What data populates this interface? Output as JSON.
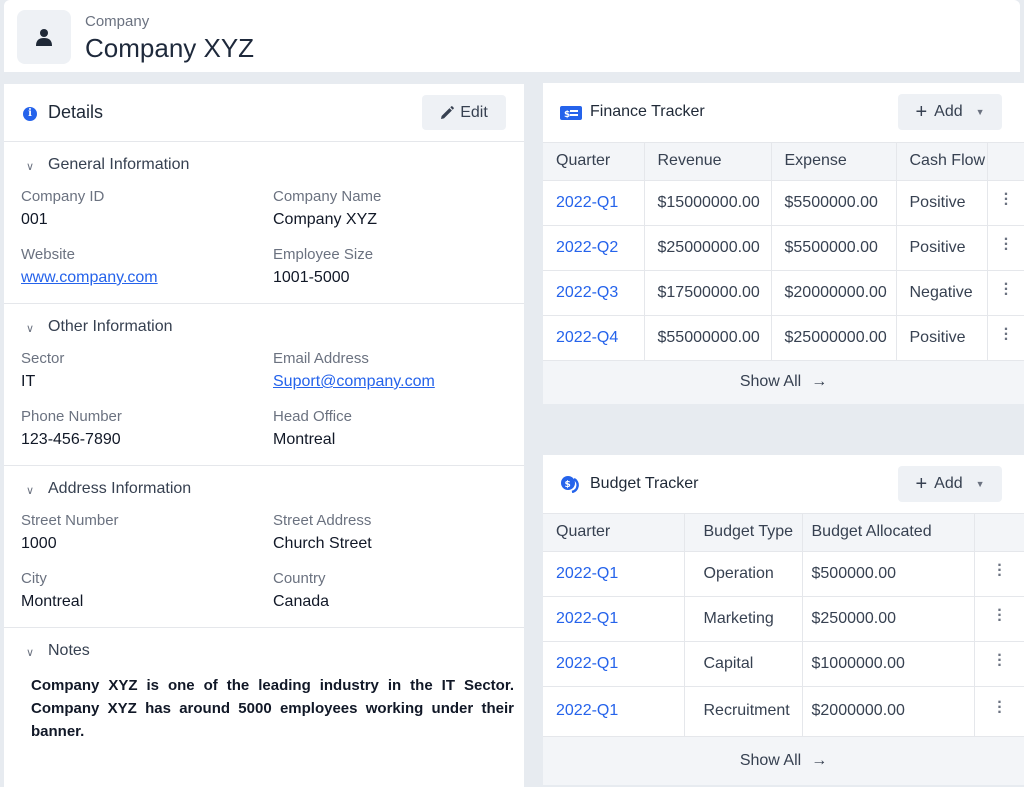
{
  "header": {
    "label": "Company",
    "title": "Company XYZ"
  },
  "details": {
    "title": "Details",
    "edit_label": "Edit",
    "general": {
      "title": "General Information",
      "company_id_label": "Company ID",
      "company_id": "001",
      "company_name_label": "Company Name",
      "company_name": "Company XYZ",
      "website_label": "Website",
      "website": "www.company.com",
      "employee_size_label": "Employee Size",
      "employee_size": "1001-5000"
    },
    "other": {
      "title": "Other Information",
      "sector_label": "Sector",
      "sector": "IT",
      "email_label": "Email Address",
      "email": "Suport@company.com",
      "phone_label": "Phone Number",
      "phone": "123-456-7890",
      "head_office_label": "Head Office",
      "head_office": "Montreal"
    },
    "address": {
      "title": "Address Information",
      "street_number_label": "Street Number",
      "street_number": "1000",
      "street_address_label": "Street Address",
      "street_address": "Church Street",
      "city_label": "City",
      "city": "Montreal",
      "country_label": "Country",
      "country": "Canada"
    },
    "notes": {
      "title": "Notes",
      "text": "Company XYZ is one of the leading industry in the IT Sector. Company XYZ has around 5000 employees working under their banner."
    }
  },
  "finance": {
    "title": "Finance Tracker",
    "add_label": "Add",
    "columns": [
      "Quarter",
      "Revenue",
      "Expense",
      "Cash Flow"
    ],
    "rows": [
      [
        "2022-Q1",
        "$15000000.00",
        "$5500000.00",
        "Positive"
      ],
      [
        "2022-Q2",
        "$25000000.00",
        "$5500000.00",
        "Positive"
      ],
      [
        "2022-Q3",
        "$17500000.00",
        "$20000000.00",
        "Negative"
      ],
      [
        "2022-Q4",
        "$55000000.00",
        "$25000000.00",
        "Positive"
      ]
    ],
    "show_all": "Show All"
  },
  "budget": {
    "title": "Budget Tracker",
    "add_label": "Add",
    "columns": [
      "Quarter",
      "Budget Type",
      "Budget Allocated"
    ],
    "rows": [
      [
        "2022-Q1",
        "Operation",
        "$500000.00"
      ],
      [
        "2022-Q1",
        "Marketing",
        "$250000.00"
      ],
      [
        "2022-Q1",
        "Capital",
        "$1000000.00"
      ],
      [
        "2022-Q1",
        "Recruitment",
        "$2000000.00"
      ]
    ],
    "show_all": "Show All"
  },
  "colors": {
    "accent": "#2563eb",
    "background": "#e7ebf0"
  }
}
